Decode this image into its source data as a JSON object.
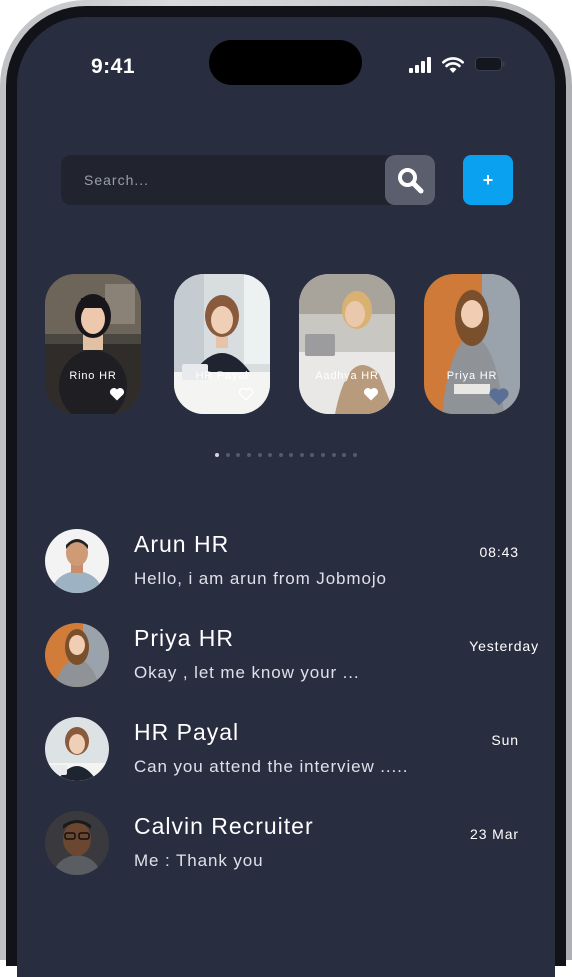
{
  "status_bar": {
    "time": "9:41",
    "icons": [
      "signal-icon",
      "wifi-icon",
      "battery-icon"
    ]
  },
  "search": {
    "placeholder": "Search...",
    "icon": "search-icon"
  },
  "add_button": {
    "label": "+"
  },
  "stories": [
    {
      "name": "Rino HR",
      "liked": true
    },
    {
      "name": "HR Payal",
      "liked": false
    },
    {
      "name": "Aadhya HR",
      "liked": true
    },
    {
      "name": "Priya HR",
      "liked": true
    }
  ],
  "pagination": {
    "count": 14,
    "active": 0
  },
  "chats": [
    {
      "name": "Arun HR",
      "message": "Hello, i am arun from Jobmojo",
      "time": "08:43"
    },
    {
      "name": "Priya HR",
      "message": "Okay , let me know your ...",
      "time": "Yesterday"
    },
    {
      "name": "HR Payal",
      "message": "Can you attend the interview .....",
      "time": "Sun"
    },
    {
      "name": "Calvin Recruiter",
      "message": "Me : Thank you",
      "time": "23 Mar"
    }
  ],
  "colors": {
    "background": "#292d40",
    "search_bg": "#21242f",
    "search_button": "#5b5e6c",
    "accent": "#0aa2f0",
    "text": "#ffffff"
  }
}
